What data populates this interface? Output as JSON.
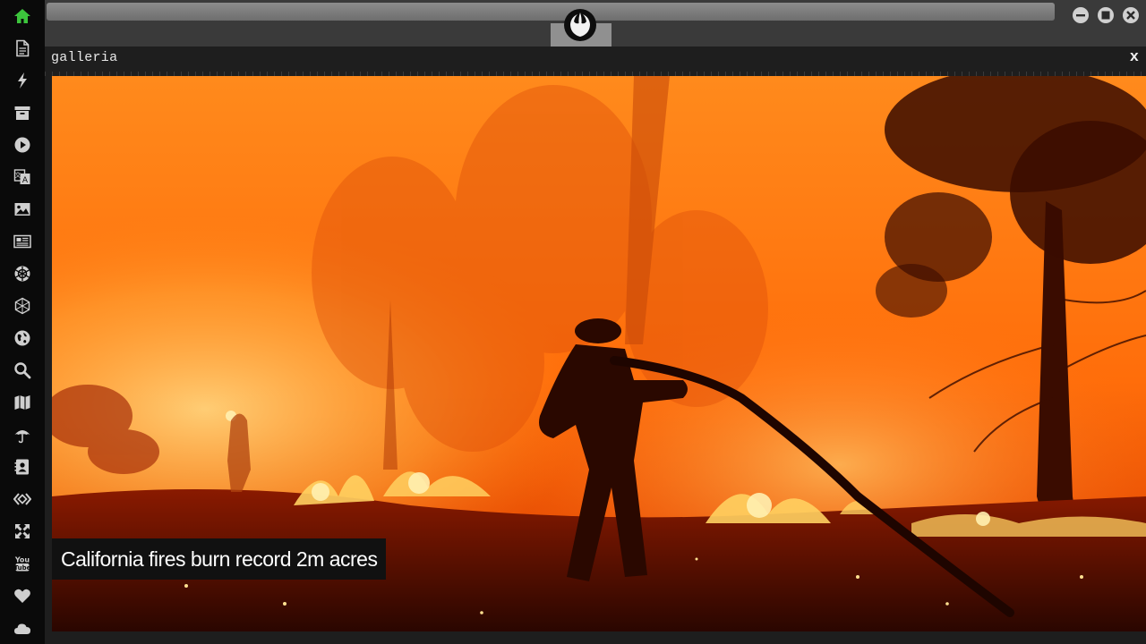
{
  "sidebar": {
    "items": [
      {
        "icon": "home-icon",
        "active": true
      },
      {
        "icon": "document-icon"
      },
      {
        "icon": "lightning-icon"
      },
      {
        "icon": "archive-icon"
      },
      {
        "icon": "play-icon"
      },
      {
        "icon": "translate-icon"
      },
      {
        "icon": "image-icon"
      },
      {
        "icon": "newspaper-icon"
      },
      {
        "icon": "rebel-emblem-icon"
      },
      {
        "icon": "hexagon-network-icon"
      },
      {
        "icon": "globe-icon"
      },
      {
        "icon": "search-icon"
      },
      {
        "icon": "map-icon"
      },
      {
        "icon": "umbrella-icon"
      },
      {
        "icon": "contact-card-icon"
      },
      {
        "icon": "code-diamond-icon"
      },
      {
        "icon": "expand-icon"
      },
      {
        "icon": "youtube-icon"
      },
      {
        "icon": "heart-icon"
      },
      {
        "icon": "cloud-icon"
      }
    ],
    "accent_color": "#3cc43c",
    "icon_color": "#cfcfcf"
  },
  "window": {
    "logo_icon": "rebel-alliance-logo-icon",
    "controls": [
      "minimize-icon",
      "maximize-icon",
      "close-icon"
    ]
  },
  "panel": {
    "title": "galleria",
    "close_label": "x"
  },
  "gallery": {
    "caption": "California fires burn record 2m acres"
  }
}
